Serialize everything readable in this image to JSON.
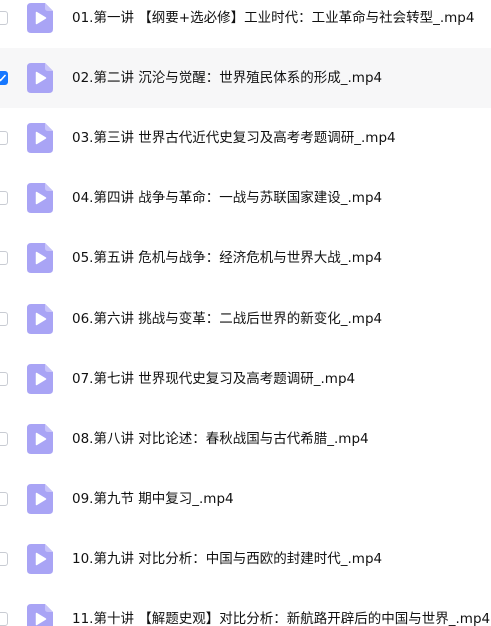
{
  "files": [
    {
      "name": "01.第一讲 【纲要+选必修】工业时代：工业革命与社会转型_.mp4",
      "checked": false,
      "icon": "video-file-icon"
    },
    {
      "name": "02.第二讲 沉沦与觉醒：世界殖民体系的形成_.mp4",
      "checked": true,
      "icon": "video-file-icon"
    },
    {
      "name": "03.第三讲 世界古代近代史复习及高考考题调研_.mp4",
      "checked": false,
      "icon": "video-file-icon"
    },
    {
      "name": "04.第四讲 战争与革命：一战与苏联国家建设_.mp4",
      "checked": false,
      "icon": "video-file-icon"
    },
    {
      "name": "05.第五讲 危机与战争：经济危机与世界大战_.mp4",
      "checked": false,
      "icon": "video-file-icon"
    },
    {
      "name": "06.第六讲 挑战与变革：二战后世界的新变化_.mp4",
      "checked": false,
      "icon": "video-file-icon"
    },
    {
      "name": "07.第七讲 世界现代史复习及高考题调研_.mp4",
      "checked": false,
      "icon": "video-file-icon"
    },
    {
      "name": "08.第八讲 对比论述：春秋战国与古代希腊_.mp4",
      "checked": false,
      "icon": "video-file-icon"
    },
    {
      "name": "09.第九节 期中复习_.mp4",
      "checked": false,
      "icon": "video-file-icon"
    },
    {
      "name": "10.第九讲 对比分析：中国与西欧的封建时代_.mp4",
      "checked": false,
      "icon": "video-file-icon"
    },
    {
      "name": "11.第十讲 【解题史观】对比分析：新航路开辟后的中国与世界_.mp4",
      "checked": false,
      "icon": "video-file-icon"
    }
  ],
  "colors": {
    "icon": "#a9a4f5",
    "play": "#ffffff",
    "accent": "#1677ff",
    "highlight": "#f7f7f8"
  }
}
